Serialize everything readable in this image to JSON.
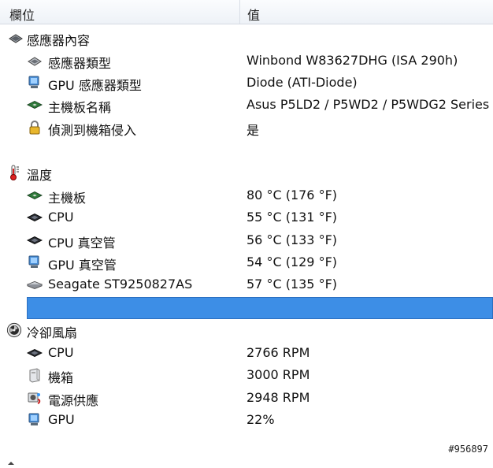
{
  "header": {
    "col_field": "欄位",
    "col_value": "值"
  },
  "sections": {
    "sensor": {
      "title": "感應器內容",
      "icon": "chip-icon",
      "rows": [
        {
          "label": "感應器類型",
          "value": "Winbond W83627DHG  (ISA 290h)",
          "icon": "chip-icon"
        },
        {
          "label": "GPU 感應器類型",
          "value": "Diode  (ATI-Diode)",
          "icon": "monitor-icon"
        },
        {
          "label": "主機板名稱",
          "value": "Asus P5LD2 / P5WD2 / P5WDG2 Series",
          "icon": "motherboard-icon"
        },
        {
          "label": "偵測到機箱侵入",
          "value": "是",
          "icon": "lock-icon"
        }
      ]
    },
    "temperature": {
      "title": "溫度",
      "icon": "thermometer-icon",
      "rows": [
        {
          "label": "主機板",
          "value": "80 °C  (176 °F)",
          "icon": "motherboard-icon"
        },
        {
          "label": "CPU",
          "value": "55 °C  (131 °F)",
          "icon": "cpu-icon"
        },
        {
          "label": "CPU 真空管",
          "value": "56 °C  (133 °F)",
          "icon": "cpu-icon"
        },
        {
          "label": "GPU 真空管",
          "value": "54 °C  (129 °F)",
          "icon": "monitor-icon"
        },
        {
          "label": "Seagate ST9250827AS",
          "value": "57 °C  (135 °F)",
          "icon": "hard-drive-icon"
        }
      ]
    },
    "cooling": {
      "title": "冷卻風扇",
      "icon": "fan-icon",
      "rows": [
        {
          "label": "CPU",
          "value": "2766 RPM",
          "icon": "cpu-icon"
        },
        {
          "label": "機箱",
          "value": "3000 RPM",
          "icon": "case-icon"
        },
        {
          "label": "電源供應",
          "value": "2948 RPM",
          "icon": "power-supply-icon"
        },
        {
          "label": "GPU",
          "value": "22%",
          "icon": "monitor-icon"
        }
      ]
    }
  },
  "watermark": "#956897",
  "colors": {
    "selection": "#3d8ee6",
    "header_bg": "#eef2f7"
  }
}
